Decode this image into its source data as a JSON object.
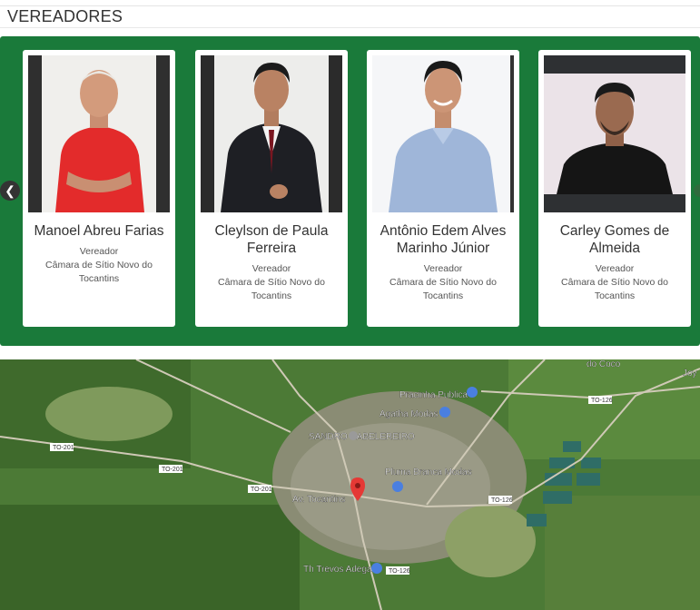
{
  "section": {
    "title": "VEREADORES"
  },
  "carousel": {
    "prev_icon": "chevron-left-icon",
    "cards": [
      {
        "name": "Manoel Abreu Farias",
        "role": "Vereador",
        "org": "Câmara de Sítio Novo do Tocantins"
      },
      {
        "name": "Cleylson de Paula Ferreira",
        "role": "Vereador",
        "org": "Câmara de Sítio Novo do Tocantins"
      },
      {
        "name": "Antônio Edem Alves Marinho Júnior",
        "role": "Vereador",
        "org": "Câmara de Sítio Novo do Tocantins"
      },
      {
        "name": "Carley Gomes de Almeida",
        "role": "Vereador",
        "org": "Câmara de Sítio Novo do Tocantins"
      }
    ]
  },
  "map": {
    "places": [
      "Pracinha Publica",
      "Agatha Modas",
      "SANDRO CABELEREIRO",
      "Pluma Branca Modas",
      "Av. Tocantins",
      "Th Trevos Adega",
      "do Coco",
      "Joy"
    ],
    "road_labels": [
      "TO-201",
      "TO-201",
      "TO-201",
      "TO-126",
      "TO-126",
      "TO-126"
    ],
    "colors": {
      "brand_green": "#1a7a3a",
      "pin": "#e53935",
      "poi": "#4a7fe0"
    }
  }
}
